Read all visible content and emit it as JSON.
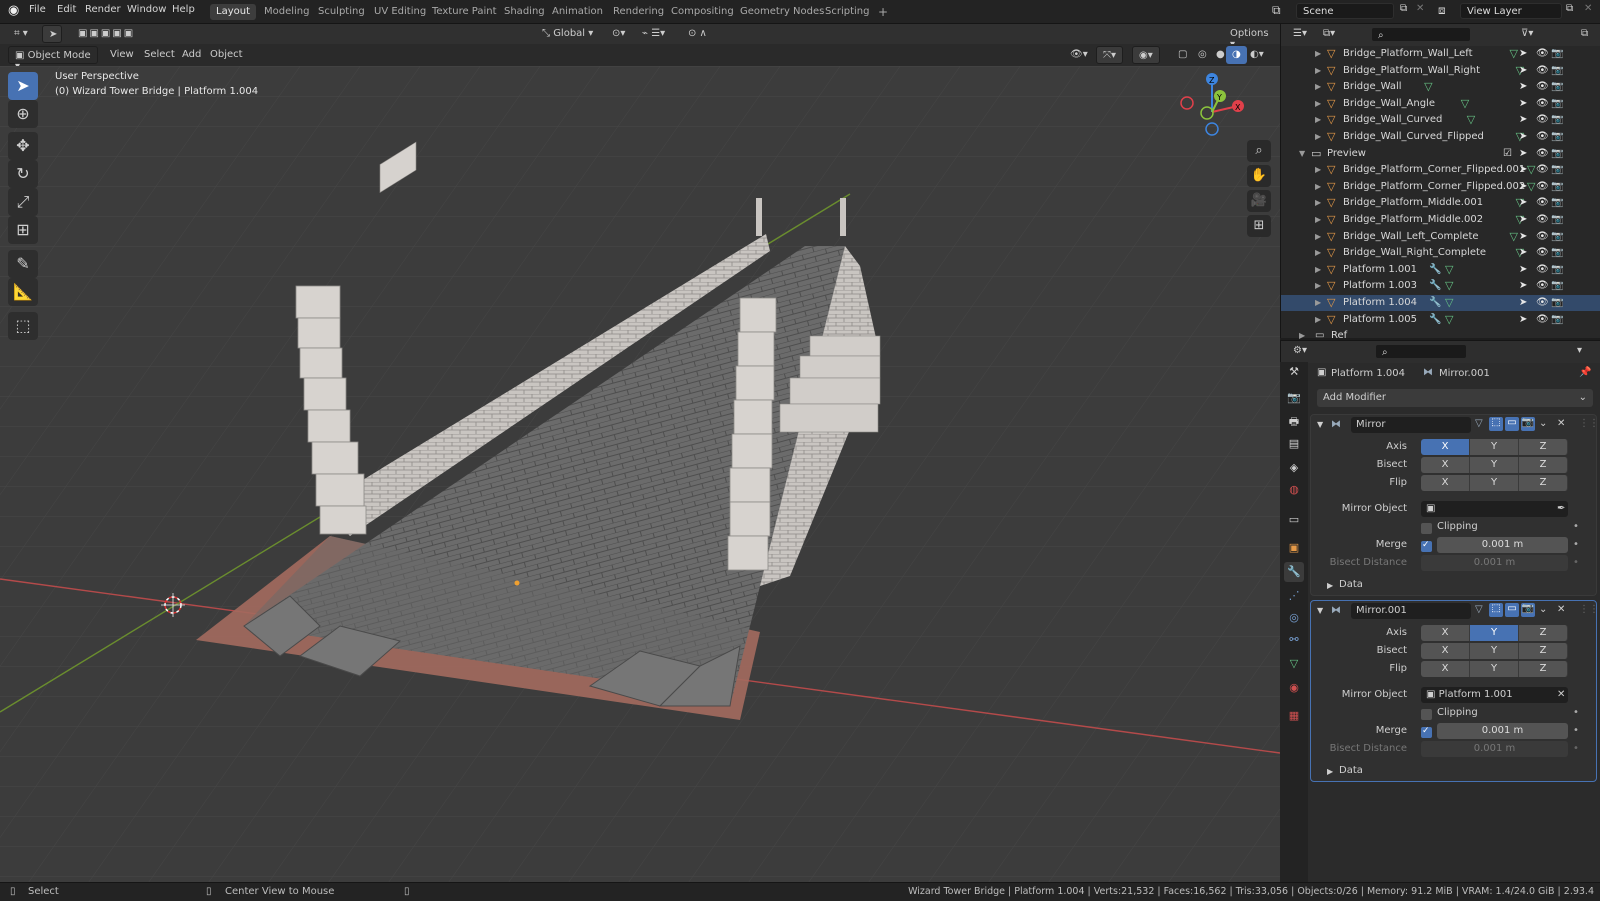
{
  "menu": [
    "File",
    "Edit",
    "Render",
    "Window",
    "Help"
  ],
  "workspaces": [
    "Layout",
    "Modeling",
    "Sculpting",
    "UV Editing",
    "Texture Paint",
    "Shading",
    "Animation",
    "Rendering",
    "Compositing",
    "Geometry Nodes",
    "Scripting"
  ],
  "active_workspace": "Layout",
  "add_workspace": "+",
  "scene": "Scene",
  "view_layer": "View Layer",
  "viewport_header": {
    "mode": "Object Mode",
    "menus": [
      "View",
      "Select",
      "Add",
      "Object"
    ],
    "transform_orientation": "Global",
    "options": "Options"
  },
  "viewport": {
    "perspective_label": "User Perspective",
    "object_label": "(0) Wizard Tower Bridge | Platform 1.004",
    "gizmo_axes": {
      "x": "X",
      "y": "Y",
      "z": "Z"
    }
  },
  "outliner": {
    "rows": [
      {
        "name": "Bridge_Platform_Wall_Left",
        "kind": "object",
        "indent": 2,
        "mesh": true,
        "mod": false,
        "selected": false
      },
      {
        "name": "Bridge_Platform_Wall_Right",
        "kind": "object",
        "indent": 2,
        "mesh": true,
        "mod": false,
        "selected": false
      },
      {
        "name": "Bridge_Wall",
        "kind": "object",
        "indent": 2,
        "mesh": true,
        "mod": false,
        "selected": false
      },
      {
        "name": "Bridge_Wall_Angle",
        "kind": "object",
        "indent": 2,
        "mesh": true,
        "mod": false,
        "selected": false
      },
      {
        "name": "Bridge_Wall_Curved",
        "kind": "object",
        "indent": 2,
        "mesh": true,
        "mod": false,
        "selected": false
      },
      {
        "name": "Bridge_Wall_Curved_Flipped",
        "kind": "object",
        "indent": 2,
        "mesh": true,
        "mod": false,
        "selected": false
      },
      {
        "name": "Preview",
        "kind": "collection",
        "indent": 1,
        "mesh": false,
        "mod": false,
        "selected": false
      },
      {
        "name": "Bridge_Platform_Corner_Flipped.001",
        "kind": "object",
        "indent": 2,
        "mesh": true,
        "mod": false,
        "selected": false
      },
      {
        "name": "Bridge_Platform_Corner_Flipped.002",
        "kind": "object",
        "indent": 2,
        "mesh": true,
        "mod": false,
        "selected": false
      },
      {
        "name": "Bridge_Platform_Middle.001",
        "kind": "object",
        "indent": 2,
        "mesh": true,
        "mod": false,
        "selected": false
      },
      {
        "name": "Bridge_Platform_Middle.002",
        "kind": "object",
        "indent": 2,
        "mesh": true,
        "mod": false,
        "selected": false
      },
      {
        "name": "Bridge_Wall_Left_Complete",
        "kind": "object",
        "indent": 2,
        "mesh": true,
        "mod": false,
        "selected": false
      },
      {
        "name": "Bridge_Wall_Right_Complete",
        "kind": "object",
        "indent": 2,
        "mesh": true,
        "mod": false,
        "selected": false
      },
      {
        "name": "Platform 1.001",
        "kind": "object",
        "indent": 2,
        "mesh": true,
        "mod": true,
        "selected": false
      },
      {
        "name": "Platform 1.003",
        "kind": "object",
        "indent": 2,
        "mesh": true,
        "mod": true,
        "selected": false
      },
      {
        "name": "Platform 1.004",
        "kind": "object",
        "indent": 2,
        "mesh": true,
        "mod": true,
        "selected": true
      },
      {
        "name": "Platform 1.005",
        "kind": "object",
        "indent": 2,
        "mesh": true,
        "mod": true,
        "selected": false
      }
    ],
    "partial_row": "Ref"
  },
  "properties": {
    "object_name": "Platform 1.004",
    "modifier_name": "Mirror.001",
    "add_modifier": "Add Modifier",
    "modifiers": [
      {
        "name": "Mirror",
        "axis": {
          "label": "Axis",
          "values": [
            "X",
            "Y",
            "Z"
          ],
          "on": [
            true,
            false,
            false
          ]
        },
        "bisect": {
          "label": "Bisect",
          "values": [
            "X",
            "Y",
            "Z"
          ],
          "on": [
            false,
            false,
            false
          ]
        },
        "flip": {
          "label": "Flip",
          "values": [
            "X",
            "Y",
            "Z"
          ],
          "on": [
            false,
            false,
            false
          ]
        },
        "mirror_object_label": "Mirror Object",
        "mirror_object": "",
        "clipping_label": "Clipping",
        "clipping": false,
        "merge_label": "Merge",
        "merge": true,
        "merge_value": "0.001 m",
        "bisect_distance_label": "Bisect Distance",
        "bisect_distance": "0.001 m",
        "data_label": "Data"
      },
      {
        "name": "Mirror.001",
        "axis": {
          "label": "Axis",
          "values": [
            "X",
            "Y",
            "Z"
          ],
          "on": [
            false,
            true,
            false
          ]
        },
        "bisect": {
          "label": "Bisect",
          "values": [
            "X",
            "Y",
            "Z"
          ],
          "on": [
            false,
            false,
            false
          ]
        },
        "flip": {
          "label": "Flip",
          "values": [
            "X",
            "Y",
            "Z"
          ],
          "on": [
            false,
            false,
            false
          ]
        },
        "mirror_object_label": "Mirror Object",
        "mirror_object": "Platform 1.001",
        "clipping_label": "Clipping",
        "clipping": false,
        "merge_label": "Merge",
        "merge": true,
        "merge_value": "0.001 m",
        "bisect_distance_label": "Bisect Distance",
        "bisect_distance": "0.001 m",
        "data_label": "Data"
      }
    ]
  },
  "status": {
    "left_action": "Select",
    "mid_action": "Center View to Mouse",
    "stats": "Wizard Tower Bridge | Platform 1.004 | Verts:21,532 | Faces:16,562 | Tris:33,056 | Objects:0/26 | Memory: 91.2 MiB | VRAM: 1.4/24.0 GiB | 2.93.4"
  },
  "colors": {
    "accent": "#4772b3",
    "object_icon": "#e69a48",
    "mesh_icon": "#66c285",
    "x_axis": "#e0404a",
    "y_axis": "#8bc43c",
    "z_axis": "#3d85e0"
  }
}
